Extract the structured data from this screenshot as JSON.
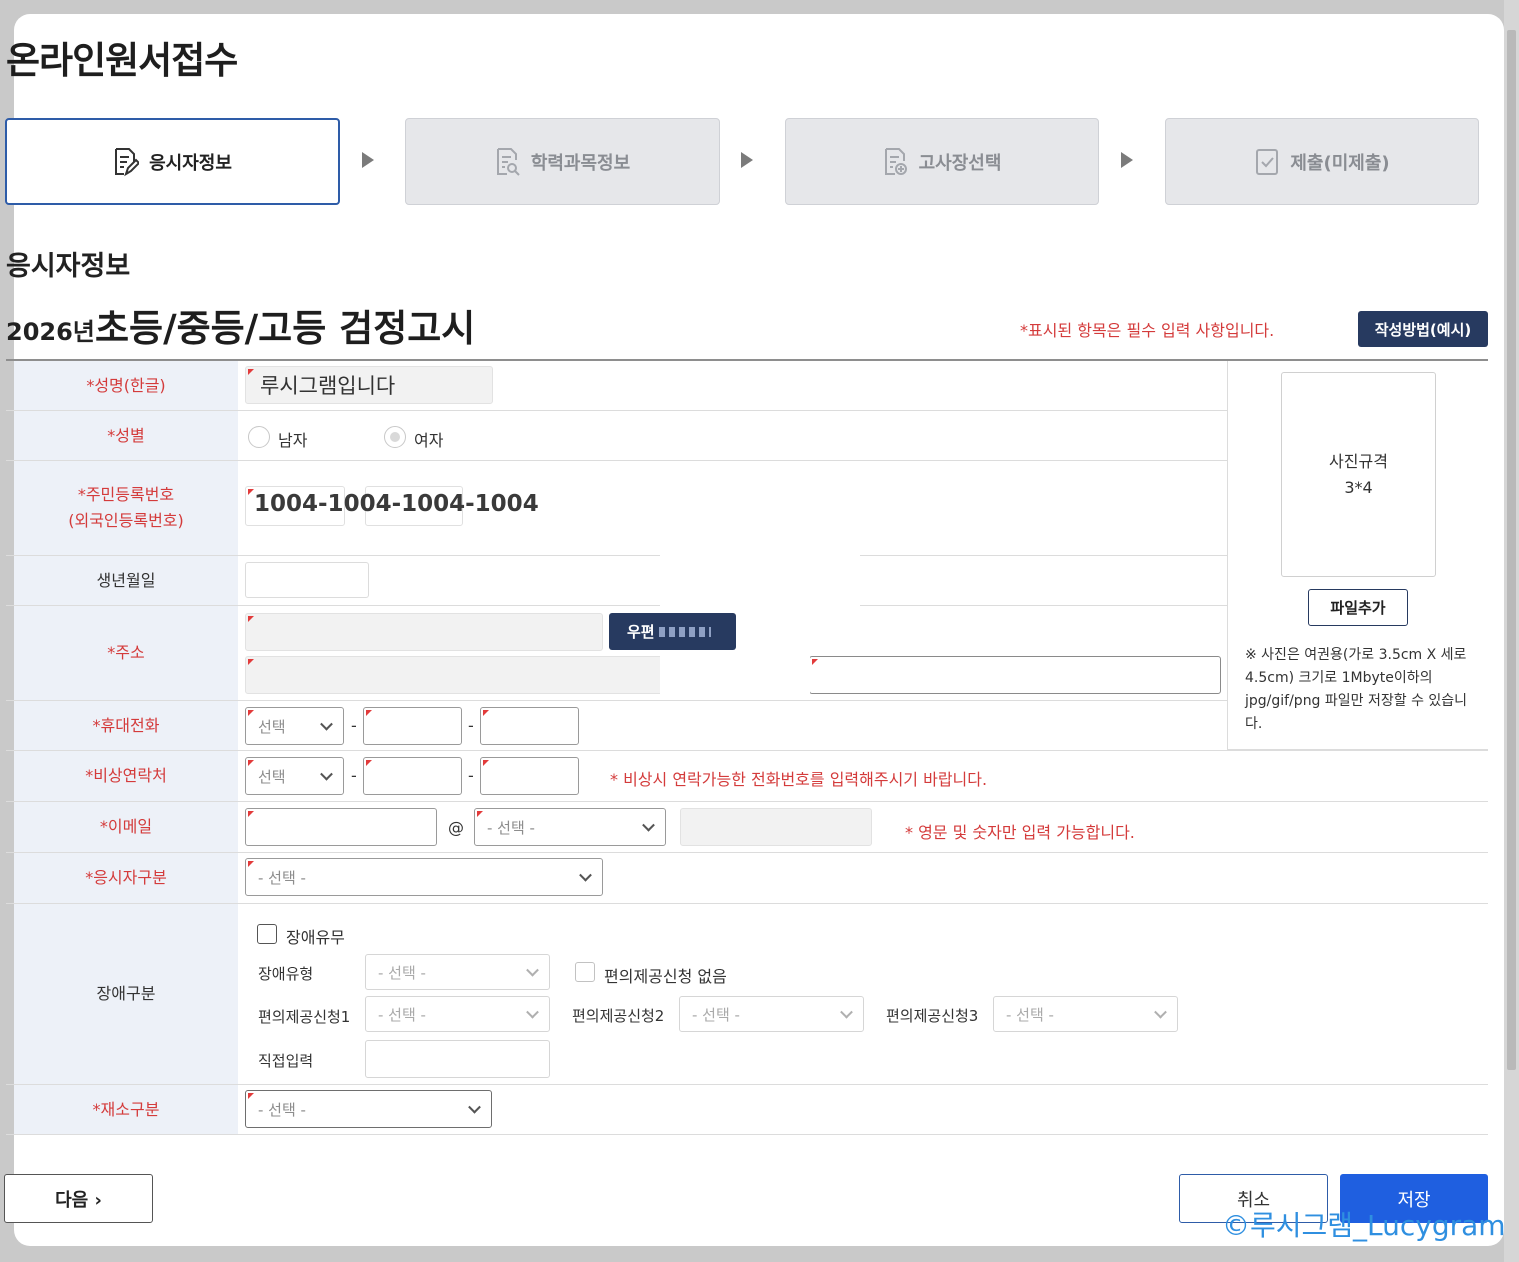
{
  "page_title": "온라인원서접수",
  "steps": [
    {
      "label": "응시자정보",
      "icon": "edit-document-icon",
      "active": true
    },
    {
      "label": "학력과목정보",
      "icon": "search-document-icon",
      "active": false
    },
    {
      "label": "고사장선택",
      "icon": "add-document-icon",
      "active": false
    },
    {
      "label": "제출(미제출)",
      "icon": "check-document-icon",
      "active": false
    }
  ],
  "section_title": "응시자정보",
  "exam_year": "2026년",
  "exam_name": "초등/중등/고등 검정고시",
  "required_note": "*표시된 항목은 필수 입력 사항입니다.",
  "howto_button": "작성방법(예시)",
  "form": {
    "name": {
      "label": "*성명(한글)",
      "value": "루시그램입니다"
    },
    "gender": {
      "label": "*성별",
      "options": [
        "남자",
        "여자"
      ],
      "selected": "여자"
    },
    "rrn": {
      "label": "*주민등록번호\n(외국인등록번호)",
      "value": "1004-1004-1004-1004"
    },
    "birth": {
      "label": "생년월일",
      "value": ""
    },
    "address": {
      "label": "*주소",
      "postcode_button": "우편"
    },
    "mobile": {
      "label": "*휴대전화",
      "prefix": "선택"
    },
    "emergency": {
      "label": "*비상연락처",
      "prefix": "선택",
      "note": "* 비상시 연락가능한 전화번호를 입력해주시기 바랍니다."
    },
    "email": {
      "label": "*이메일",
      "at": "@",
      "domain_select": "- 선택 -",
      "note": "* 영문 및 숫자만 입력 가능합니다."
    },
    "applicant_type": {
      "label": "*응시자구분",
      "select": "- 선택 -"
    },
    "disability": {
      "label": "장애구분",
      "has_disability": "장애유무",
      "type_label": "장애유형",
      "type_select": "- 선택 -",
      "no_accommodation": "편의제공신청 없음",
      "accommodation1_label": "편의제공신청1",
      "accommodation1_select": "- 선택 -",
      "accommodation2_label": "편의제공신청2",
      "accommodation2_select": "- 선택 -",
      "accommodation3_label": "편의제공신청3",
      "accommodation3_select": "- 선택 -",
      "direct_label": "직접입력"
    },
    "residence": {
      "label": "*재소구분",
      "select": "- 선택 -"
    }
  },
  "photo": {
    "spec_line1": "사진규격",
    "spec_line2": "3*4",
    "add_button": "파일추가",
    "note": "※ 사진은 여권용(가로 3.5cm X 세로 4.5cm) 크기로 1Mbyte이하의 jpg/gif/png 파일만 저장할 수 있습니다."
  },
  "buttons": {
    "next": "다음 ›",
    "cancel": "취소",
    "save": "저장"
  },
  "watermark": "©루시그램_Lucygram"
}
